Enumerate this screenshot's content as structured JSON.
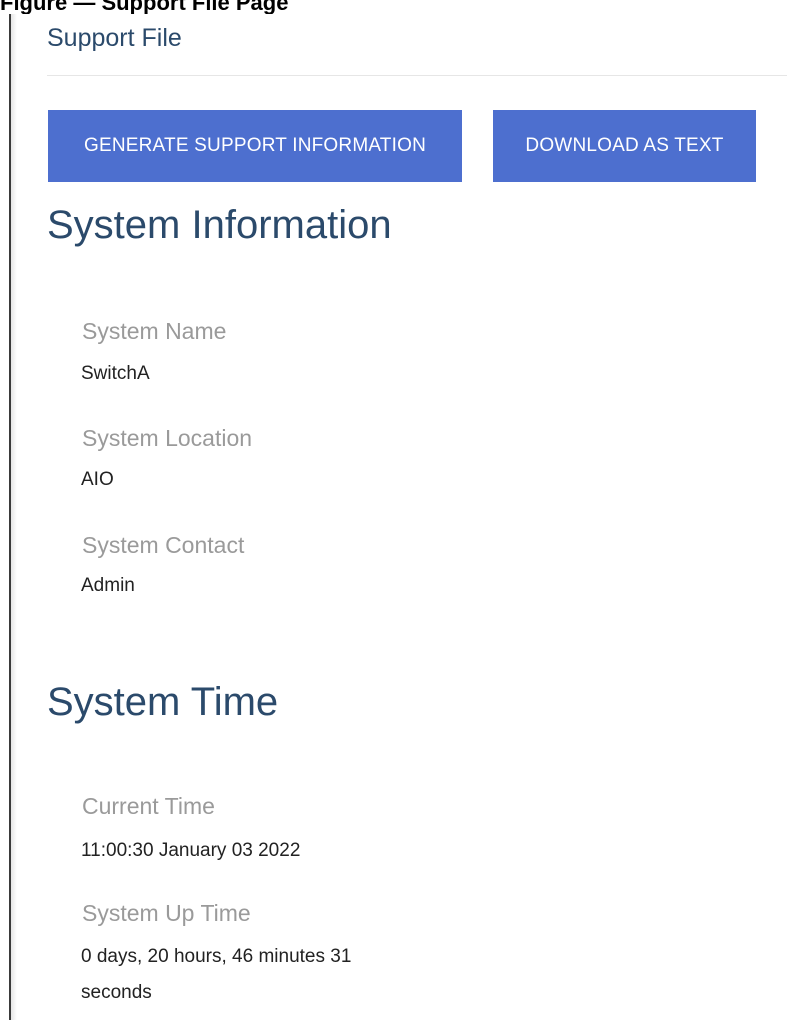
{
  "caption": "Figure — Support File Page",
  "panel": {
    "title": "Support File"
  },
  "buttons": {
    "generate": "GENERATE SUPPORT INFORMATION",
    "download": "DOWNLOAD AS TEXT"
  },
  "system_information": {
    "heading": "System Information",
    "fields": [
      {
        "label": "System Name",
        "value": "SwitchA"
      },
      {
        "label": "System Location",
        "value": "AIO"
      },
      {
        "label": "System Contact",
        "value": "Admin"
      }
    ]
  },
  "system_time": {
    "heading": "System Time",
    "fields": [
      {
        "label": "Current Time",
        "value": "11:00:30 January 03 2022"
      },
      {
        "label": "System Up Time",
        "value": "0 days, 20 hours, 46 minutes 31 seconds"
      }
    ]
  }
}
